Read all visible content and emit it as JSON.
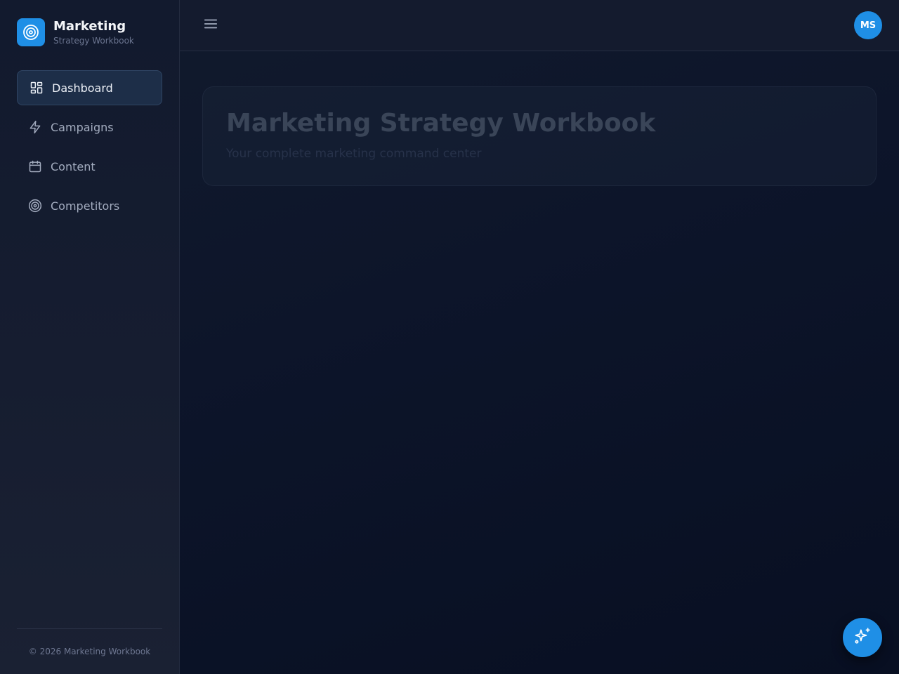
{
  "brand": {
    "title": "Marketing",
    "subtitle": "Strategy Workbook",
    "logo_icon": "target-icon"
  },
  "nav": {
    "items": [
      {
        "label": "Dashboard",
        "icon": "dashboard-icon",
        "active": true
      },
      {
        "label": "Campaigns",
        "icon": "lightning-icon",
        "active": false
      },
      {
        "label": "Content",
        "icon": "calendar-icon",
        "active": false
      },
      {
        "label": "Competitors",
        "icon": "target-icon",
        "active": false
      }
    ]
  },
  "footer": {
    "copyright": "© 2026 Marketing Workbook"
  },
  "topbar": {
    "menu_icon": "hamburger-menu-icon",
    "avatar_initials": "MS"
  },
  "hero": {
    "title": "Marketing Strategy Workbook",
    "subtitle": "Your complete marketing command center"
  },
  "fab": {
    "icon": "sparkles-icon"
  },
  "colors": {
    "accent": "#1f8fe6",
    "sidebar_bg": "#161d30",
    "main_bg": "#0b1326",
    "active_nav_bg": "#1d2e48"
  }
}
